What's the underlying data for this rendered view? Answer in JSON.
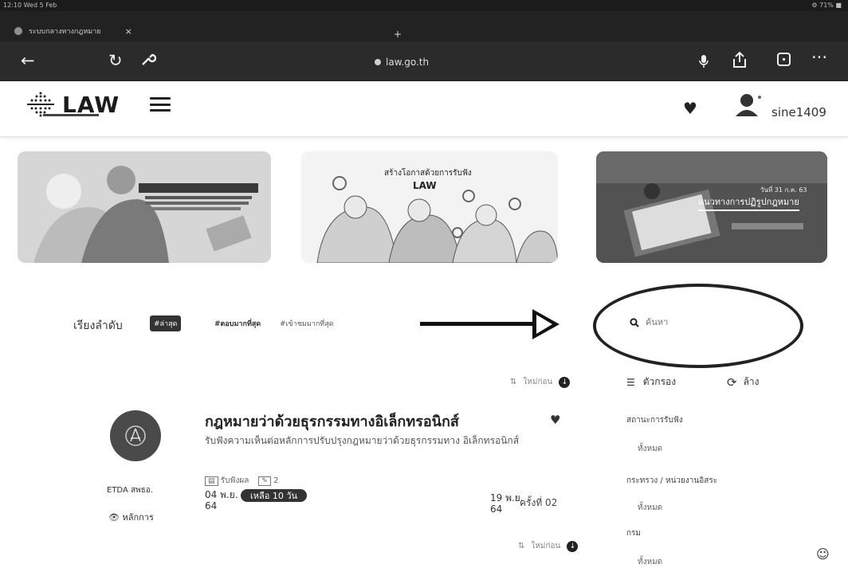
{
  "status_bar": {
    "time": "12:10 Wed 5 Feb",
    "system": "⚙ 71% ■"
  },
  "browser": {
    "tab_title": "ระบบกลางทางกฎหมาย",
    "tab_close": "×",
    "new_tab": "+",
    "url": "law.go.th",
    "icons": [
      "back-icon",
      "reload-icon",
      "settings-wrench-icon",
      "mic-icon",
      "share-icon",
      "tabs-icon",
      "more-icon"
    ]
  },
  "header": {
    "logo_text": "LAW",
    "username": "sine1409"
  },
  "banners": {
    "center_title": "สร้างโอกาสด้วยการรับฟัง",
    "center_logo": "LAW",
    "right_small": "วันที่ 31 ก.ค. 63",
    "right_title": "แนวทางการปฏิรูปกฎหมาย"
  },
  "sort": {
    "label": "เรียงลำดับ",
    "options": [
      "#ล่าสุด",
      "#ตอบมากที่สุด",
      "#เข้าชมมากที่สุด"
    ],
    "active_index": 0
  },
  "search": {
    "placeholder": "ค้นหา"
  },
  "list_controls": {
    "sort_toggle_label": "ใหม่ก่อน",
    "sort_toggle_label_bottom": "ใหม่ก่อน"
  },
  "filter": {
    "title": "ตัวกรอง",
    "clear": "ล้าง",
    "groups": [
      {
        "label": "สถานะการรับฟัง",
        "value": "ทั้งหมด"
      },
      {
        "label": "กระทรวง / หน่วยงานอิสระ",
        "value": "ทั้งหมด"
      },
      {
        "label": "กรม",
        "value": "ทั้งหมด"
      }
    ]
  },
  "law_item": {
    "org_name": "ETDA สพธอ.",
    "principle_label": "หลักการ",
    "title": "กฎหมายว่าด้วยธุรกรรมทางอิเล็กทรอนิกส์",
    "description": "รับฟังความเห็นต่อหลักการปรับปรุงกฎหมายว่าด้วยธุรกรรมทาง อิเล็กทรอนิกส์",
    "meta_views": "รับฟังผล",
    "meta_comments": "2",
    "start_date": "04 พ.ย.",
    "start_year": "64",
    "remaining_badge": "เหลือ 10 วัน",
    "end_date": "19 พ.ย.",
    "end_year": "64",
    "round_label": "ครั้งที่ 02"
  }
}
